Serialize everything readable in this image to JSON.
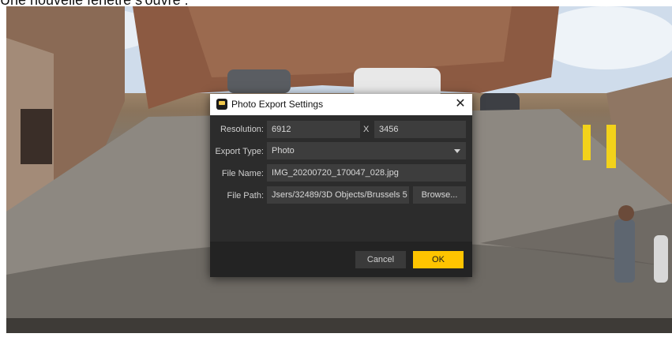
{
  "caption": "Une nouvelle fenêtre s'ouvre :",
  "dialog": {
    "title": "Photo Export Settings",
    "close_glyph": "✕",
    "resolution": {
      "label": "Resolution:",
      "width": "6912",
      "separator": "X",
      "height": "3456"
    },
    "export_type": {
      "label": "Export Type:",
      "value": "Photo"
    },
    "file_name": {
      "label": "File Name:",
      "value": "IMG_20200720_170047_028.jpg"
    },
    "file_path": {
      "label": "File Path:",
      "value": "Jsers/32489/3D Objects/Brussels 5",
      "browse_label": "Browse..."
    },
    "cancel_label": "Cancel",
    "ok_label": "OK"
  },
  "colors": {
    "accent": "#ffc400",
    "dialog_bg": "#2c2c2c",
    "field_bg": "#3d3d3d"
  }
}
